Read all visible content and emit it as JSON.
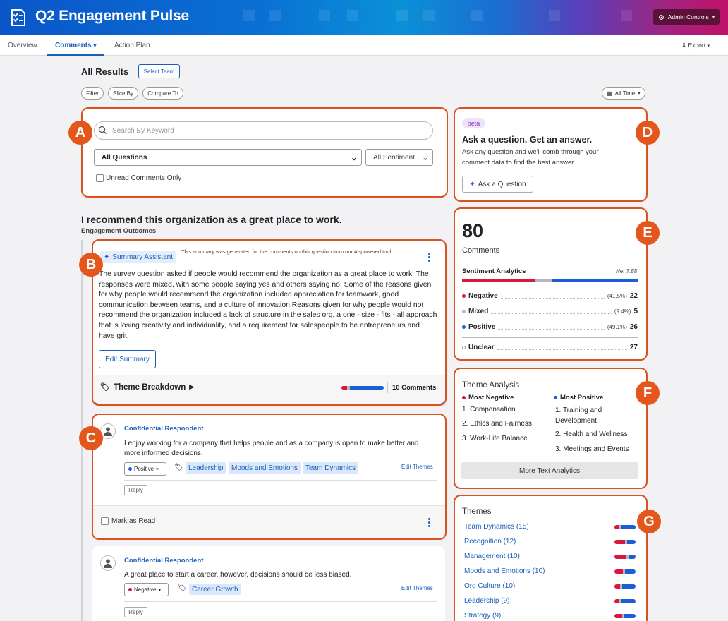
{
  "header": {
    "title": "Q2 Engagement Pulse",
    "admin_label": "Admin Controls"
  },
  "nav": {
    "tabs": [
      "Overview",
      "Comments",
      "Action Plan"
    ],
    "export_label": "Export"
  },
  "toolbar": {
    "heading": "All Results",
    "select_team": "Select Team",
    "filter": "Filter",
    "slice_by": "Slice By",
    "compare_to": "Compare To",
    "time": "All Time"
  },
  "search": {
    "placeholder": "Search By Keyword",
    "question_select": "All Questions",
    "sentiment_select": "All Sentiment",
    "unread_label": "Unread Comments Only"
  },
  "markers": [
    "A",
    "B",
    "C",
    "D",
    "E",
    "F",
    "G"
  ],
  "question": {
    "title": "I recommend this organization as a great place to work.",
    "subtitle": "Engagement Outcomes"
  },
  "summary": {
    "badge": "Summary Assistant",
    "note": "This summary was generated for the comments on this question from our AI-powered tool.",
    "text": "The survey question asked if people would recommend the organization as a great place to work. The responses were mixed, with some people saying yes and others saying no. Some of the reasons given for why people would recommend the organization included appreciation for teamwork, good communication between teams, and a culture of innovation.Reasons given for why people would not recommend the organization included a lack of structure in the sales org, a one - size - fits - all approach that is losing creativity and individuality, and a requirement for salespeople to be entrepreneurs and have grit.",
    "edit_label": "Edit Summary",
    "theme_breakdown": "Theme Breakdown",
    "comment_count": "10 Comments"
  },
  "comments": [
    {
      "author": "Confidential Respondent",
      "text": "I enjoy working for a company that helps people and as a company is open to make better and more informed decisions.",
      "sentiment": "Positive",
      "sentiment_color": "#1a5fd8",
      "tags": [
        "Leadership",
        "Moods and Emotions",
        "Team Dynamics"
      ],
      "edit_themes": "Edit Themes",
      "reply": "Reply",
      "mark_read": "Mark as Read"
    },
    {
      "author": "Confidential Respondent",
      "text": "A great place to start a career, however, decisions should be less biased.",
      "sentiment": "Negative",
      "sentiment_color": "#d8173a",
      "tags": [
        "Career Growth"
      ],
      "edit_themes": "Edit Themes",
      "reply": "Reply"
    }
  ],
  "ask": {
    "beta": "beta",
    "title": "Ask a question. Get an answer.",
    "desc": "Ask any question and we'll comb through your comment data to find the best answer.",
    "button": "Ask a Question"
  },
  "sentiment": {
    "count": "80",
    "count_label": "Comments",
    "heading": "Sentiment Analytics",
    "net": "Net 7.55",
    "rows": [
      {
        "label": "Negative",
        "pct": "(41.5%)",
        "value": "22",
        "color": "#d8173a",
        "fraction": 0.415
      },
      {
        "label": "Mixed",
        "pct": "(9.4%)",
        "value": "5",
        "color": "#b8b8c4",
        "fraction": 0.094
      },
      {
        "label": "Positive",
        "pct": "(49.1%)",
        "value": "26",
        "color": "#1a5fd8",
        "fraction": 0.491
      }
    ],
    "unclear": {
      "label": "Unclear",
      "value": "27"
    }
  },
  "theme_analysis": {
    "title": "Theme Analysis",
    "neg_heading": "Most Negative",
    "pos_heading": "Most Positive",
    "negative": [
      "1. Compensation",
      "2. Ethics and Fairness",
      "3. Work-Life Balance"
    ],
    "positive": [
      "1. Training and Development",
      "2. Health and Wellness",
      "3. Meetings and Events"
    ],
    "more_button": "More Text Analytics"
  },
  "themes": {
    "title": "Themes",
    "items": [
      {
        "label": "Team Dynamics  (15)",
        "neg": 0.2,
        "mix": 0.1,
        "pos": 0.7
      },
      {
        "label": "Recognition  (12)",
        "neg": 0.5,
        "mix": 0.1,
        "pos": 0.4
      },
      {
        "label": "Management  (10)",
        "neg": 0.55,
        "mix": 0.1,
        "pos": 0.35
      },
      {
        "label": "Moods and Emotions  (10)",
        "neg": 0.4,
        "mix": 0.1,
        "pos": 0.5
      },
      {
        "label": "Org Culture  (10)",
        "neg": 0.25,
        "mix": 0.1,
        "pos": 0.65
      },
      {
        "label": "Leadership  (9)",
        "neg": 0.2,
        "mix": 0.1,
        "pos": 0.7
      },
      {
        "label": "Strategy  (9)",
        "neg": 0.35,
        "mix": 0.1,
        "pos": 0.55
      }
    ]
  },
  "colors": {
    "accent": "#1a5fb8",
    "marker": "#e4561c",
    "negative": "#d8173a",
    "positive": "#1a5fd8",
    "mixed": "#b8b8c4"
  }
}
